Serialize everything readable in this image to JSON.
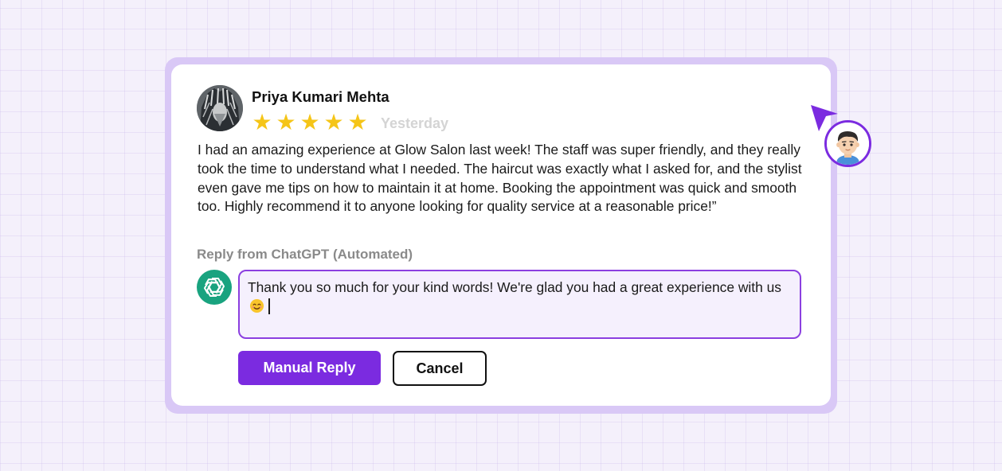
{
  "review": {
    "reviewer_name": "Priya Kumari Mehta",
    "rating": 5,
    "rating_max": 5,
    "date": "Yesterday",
    "text": "I had an amazing experience at Glow Salon last week! The staff was super friendly, and they really took the time to understand what I needed. The haircut was exactly what I asked for, and the stylist even gave me tips on how to maintain it at home. Booking the appointment was quick and smooth too. Highly recommend it to anyone looking for quality service at a reasonable price!”"
  },
  "reply": {
    "heading": "Reply from ChatGPT (Automated)",
    "value": "Thank you so much for your kind words! We're glad you had a great experience with us",
    "emoji": "smiling-face-icon"
  },
  "actions": {
    "manual_reply_label": "Manual Reply",
    "cancel_label": "Cancel"
  },
  "icons": {
    "star": "★",
    "bot": "chatgpt-logo-icon",
    "cursor": "pointer-arrow-icon",
    "user": "user-avatar-icon"
  },
  "colors": {
    "accent": "#7b2be0",
    "star": "#f5c518",
    "bot_green": "#19a37f",
    "frame": "#d9c8f6",
    "reply_bg": "#f5f0fd"
  }
}
